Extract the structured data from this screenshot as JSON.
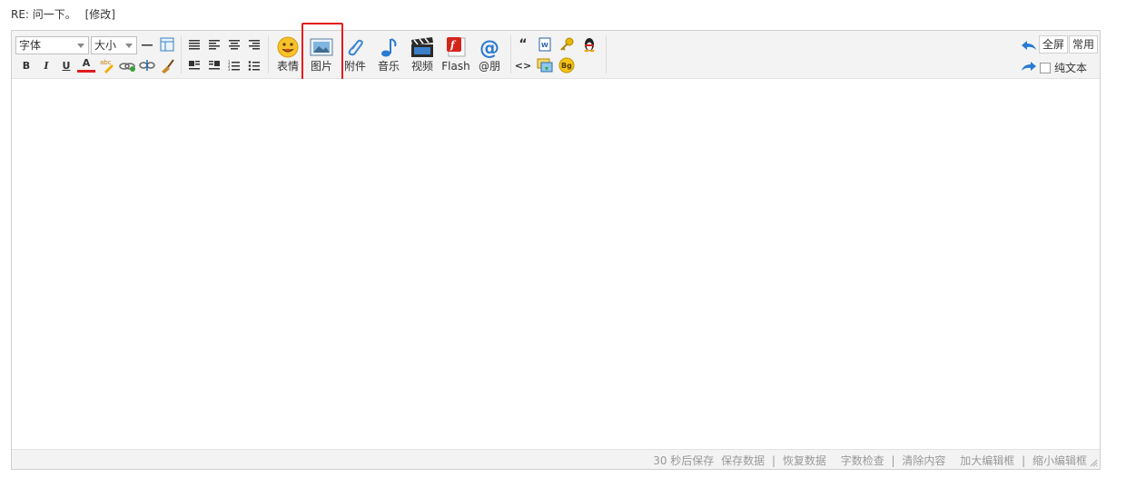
{
  "post": {
    "title": "RE: 问一下。",
    "edit_link": "[修改]"
  },
  "toolbar": {
    "font_combo": "字体",
    "size_combo": "大小",
    "media": [
      {
        "id": "emoticon",
        "label": "表情"
      },
      {
        "id": "image",
        "label": "图片"
      },
      {
        "id": "attachment",
        "label": "附件"
      },
      {
        "id": "music",
        "label": "音乐"
      },
      {
        "id": "video",
        "label": "视频"
      },
      {
        "id": "flash",
        "label": "Flash"
      },
      {
        "id": "mention",
        "label": "@朋"
      }
    ],
    "right": {
      "fullscreen": "全屏",
      "common": "常用",
      "plain_text": "纯文本"
    },
    "bold": "B",
    "italic": "I",
    "underline": "U",
    "font_color": "A",
    "quote": "“",
    "code": "<>"
  },
  "status": {
    "autosave": "30 秒后保存",
    "save_data": "保存数据",
    "restore_data": "恢复数据",
    "word_check": "字数检查",
    "clear": "清除内容",
    "enlarge": "加大编辑框",
    "shrink": "缩小编辑框"
  },
  "colors": {
    "highlight": "#e41d1d",
    "accent_blue": "#2a7ad2"
  }
}
